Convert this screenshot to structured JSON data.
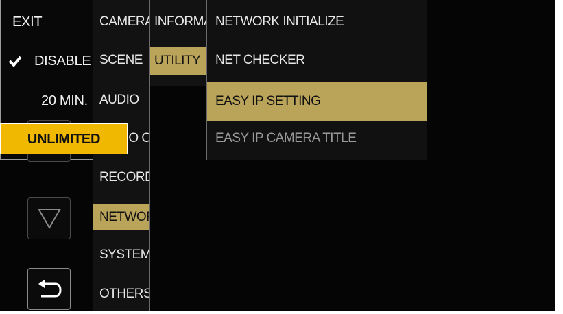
{
  "controls": {
    "up_icon": "triangle-up-outline",
    "down_icon": "triangle-down-outline",
    "back_icon": "return-arrow"
  },
  "menu_level1": {
    "items": [
      {
        "label": "CAMERA",
        "selected": false
      },
      {
        "label": "SCENE",
        "selected": false
      },
      {
        "label": "AUDIO",
        "selected": false
      },
      {
        "label": "VIDEO OUT",
        "selected": false
      },
      {
        "label": "RECORDING",
        "selected": false
      },
      {
        "label": "NETWORK",
        "selected": true
      },
      {
        "label": "SYSTEM",
        "selected": false
      },
      {
        "label": "OTHERS",
        "selected": false
      }
    ]
  },
  "menu_level2": {
    "items": [
      {
        "label": "INFORMATION",
        "selected": false
      },
      {
        "label": "UTILITY",
        "selected": true
      }
    ]
  },
  "menu_level3": {
    "items": [
      {
        "label": "NETWORK INITIALIZE",
        "selected": false,
        "enabled": true
      },
      {
        "label": "NET CHECKER",
        "selected": false,
        "enabled": true
      },
      {
        "label": "EASY IP SETTING",
        "selected": true,
        "enabled": true
      },
      {
        "label": "EASY IP CAMERA TITLE",
        "selected": false,
        "enabled": false
      }
    ]
  },
  "options": {
    "exit_label": "EXIT",
    "items": [
      {
        "label": "DISABLE",
        "checked": true,
        "highlighted": false
      },
      {
        "label": "20 MIN.",
        "checked": false,
        "highlighted": false
      },
      {
        "label": "UNLIMITED",
        "checked": false,
        "highlighted": true
      }
    ],
    "highlight_color": "#f0b800",
    "menu_selection_color": "#b9a45a"
  }
}
